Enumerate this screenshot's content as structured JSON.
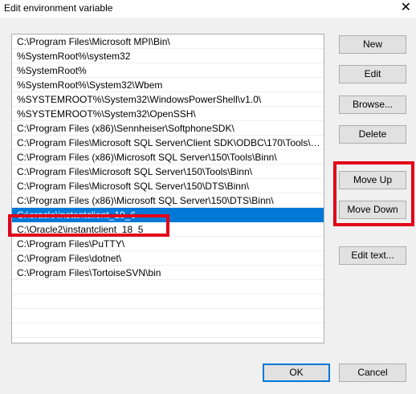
{
  "window": {
    "title": "Edit environment variable",
    "close_glyph": "✕"
  },
  "paths": [
    "C:\\Program Files\\Microsoft MPI\\Bin\\",
    "%SystemRoot%\\system32",
    "%SystemRoot%",
    "%SystemRoot%\\System32\\Wbem",
    "%SYSTEMROOT%\\System32\\WindowsPowerShell\\v1.0\\",
    "%SYSTEMROOT%\\System32\\OpenSSH\\",
    "C:\\Program Files (x86)\\Sennheiser\\SoftphoneSDK\\",
    "C:\\Program Files\\Microsoft SQL Server\\Client SDK\\ODBC\\170\\Tools\\Bi...",
    "C:\\Program Files (x86)\\Microsoft SQL Server\\150\\Tools\\Binn\\",
    "C:\\Program Files\\Microsoft SQL Server\\150\\Tools\\Binn\\",
    "C:\\Program Files\\Microsoft SQL Server\\150\\DTS\\Binn\\",
    "C:\\Program Files (x86)\\Microsoft SQL Server\\150\\DTS\\Binn\\",
    "C:\\oracle\\instantclient_19_6",
    "C:\\Oracle2\\instantclient_18_5",
    "C:\\Program Files\\PuTTY\\",
    "C:\\Program Files\\dotnet\\",
    "C:\\Program Files\\TortoiseSVN\\bin",
    "",
    "",
    "",
    ""
  ],
  "selected_index": 12,
  "buttons": {
    "new": "New",
    "edit": "Edit",
    "browse": "Browse...",
    "delete": "Delete",
    "move_up": "Move Up",
    "move_down": "Move Down",
    "edit_text": "Edit text...",
    "ok": "OK",
    "cancel": "Cancel"
  },
  "colors": {
    "selection": "#0078d7",
    "highlight": "#e2001a"
  }
}
